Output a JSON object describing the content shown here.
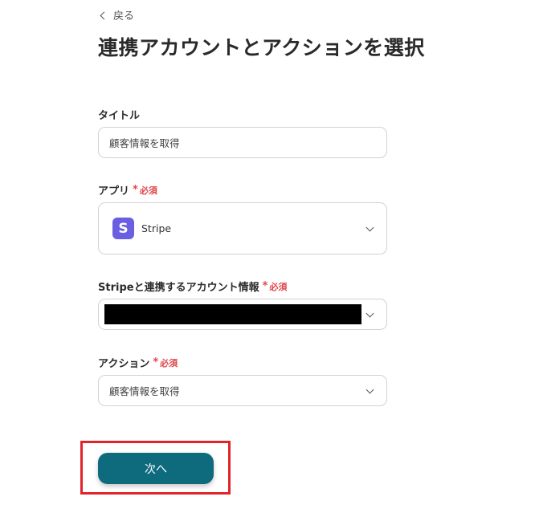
{
  "header": {
    "back_label": "戻る",
    "title": "連携アカウントとアクションを選択"
  },
  "form": {
    "title_field": {
      "label": "タイトル",
      "value": "顧客情報を取得"
    },
    "app_field": {
      "label": "アプリ",
      "required_star": "*",
      "required_label": "必須",
      "logo_letter": "S",
      "value": "Stripe",
      "logo_color": "#6a5fe0"
    },
    "account_field": {
      "label": "Stripeと連携するアカウント情報",
      "required_star": "*",
      "required_label": "必須"
    },
    "action_field": {
      "label": "アクション",
      "required_star": "*",
      "required_label": "必須",
      "value": "顧客情報を取得"
    }
  },
  "footer": {
    "next_label": "次へ"
  },
  "colors": {
    "primary_button": "#0e6b7e",
    "required": "#e0464b",
    "highlight": "#e0242a"
  }
}
